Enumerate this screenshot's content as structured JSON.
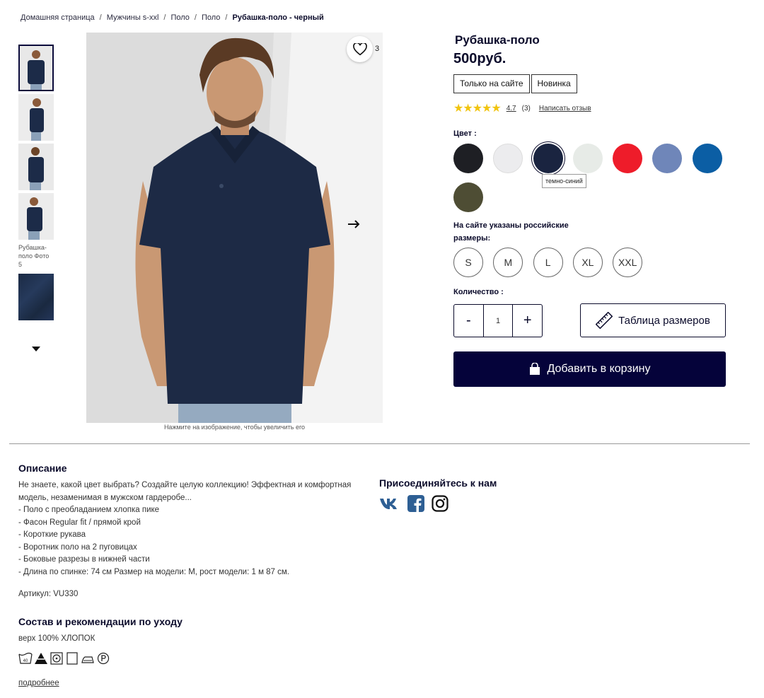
{
  "breadcrumb": {
    "home": "Домашняя страница",
    "cat1": "Мужчины s-xxl",
    "cat2": "Поло",
    "cat3": "Поло",
    "current": "Рубашка-поло - черный",
    "separator": "/"
  },
  "gallery": {
    "broken_alt": "Рубашка-поло Фото 5",
    "favorites_count": "3",
    "caption": "Нажмите на изображение, чтобы увеличить его"
  },
  "product": {
    "title": "Рубашка-поло",
    "price": "500руб.",
    "badges": [
      "Только на сайте",
      "Новинка"
    ],
    "stars": "★★★★★",
    "rating": "4.7",
    "reviews_count": "(3)",
    "write_review": "Написать отзыв",
    "color_label": "Цвет :",
    "selected_color_tooltip": "темно-синий",
    "colors": [
      "#1e1f24",
      "#ececee",
      "#1a2440",
      "#e7ebe7",
      "#ee1c2a",
      "#6f86b9",
      "#0b5ea4",
      "#4e4d34"
    ],
    "sizes_label": "На сайте указаны российские размеры:",
    "sizes": [
      "S",
      "M",
      "L",
      "XL",
      "XXL"
    ],
    "quantity_label": "Количество :",
    "quantity": "1",
    "minus": "-",
    "plus": "+",
    "size_table": "Таблица размеров",
    "add_to_cart": "Добавить в корзину"
  },
  "description": {
    "heading": "Описание",
    "lines": [
      "Не знаете, какой цвет выбрать? Создайте целую коллекцию! Эффектная и комфортная модель, незаменимая в мужском гардеробе...",
      "- Поло с преобладанием хлопка пике",
      "- Фасон Regular fit / прямой крой",
      "- Короткие рукава",
      "- Воротник поло на 2 пуговицах",
      "- Боковые разрезы в нижней части",
      "- Длина по спинке: 74 см Размер на модели: M, рост модели: 1 м 87 см."
    ],
    "sku": "Артикул: VU330",
    "composition_heading": "Состав и рекомендации по уходу",
    "composition": "верх 100% ХЛОПОК",
    "care_wash_temp": "40",
    "more": "подробнее"
  },
  "social": {
    "heading": "Присоединяйтесь к нам"
  }
}
